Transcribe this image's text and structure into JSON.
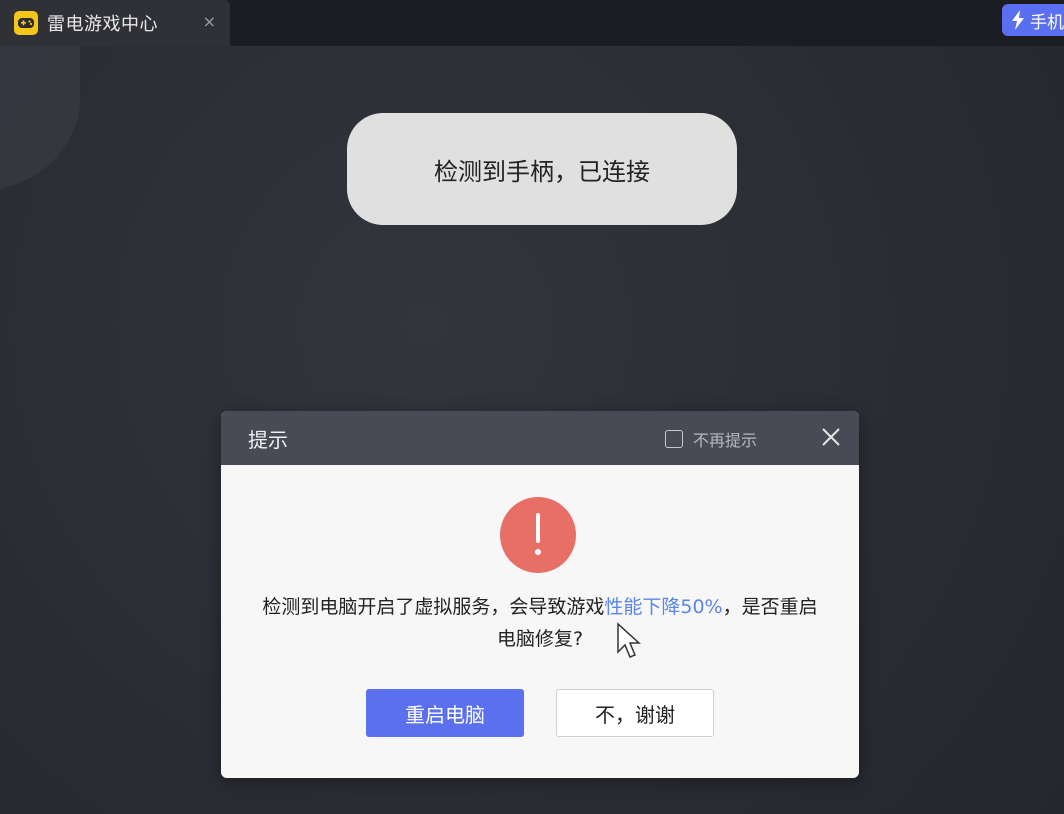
{
  "tab": {
    "title": "雷电游戏中心",
    "close_label": "×",
    "logo_icon": "gamepad-icon"
  },
  "phone_button": {
    "label": "手机",
    "icon": "lightning-icon"
  },
  "toast": {
    "text": "检测到手柄，已连接"
  },
  "dialog": {
    "title": "提示",
    "no_remind_label": "不再提示",
    "icon": "warning-icon",
    "message_part1": "检测到电脑开启了虚拟服务，会导致游戏",
    "message_highlight": "性能下降50%",
    "message_part2": "，是否重启电脑修复?",
    "confirm_label": "重启电脑",
    "cancel_label": "不，谢谢"
  },
  "colors": {
    "accent": "#5b70ee",
    "warning": "#e76f66",
    "highlight_text": "#5b85e8"
  }
}
